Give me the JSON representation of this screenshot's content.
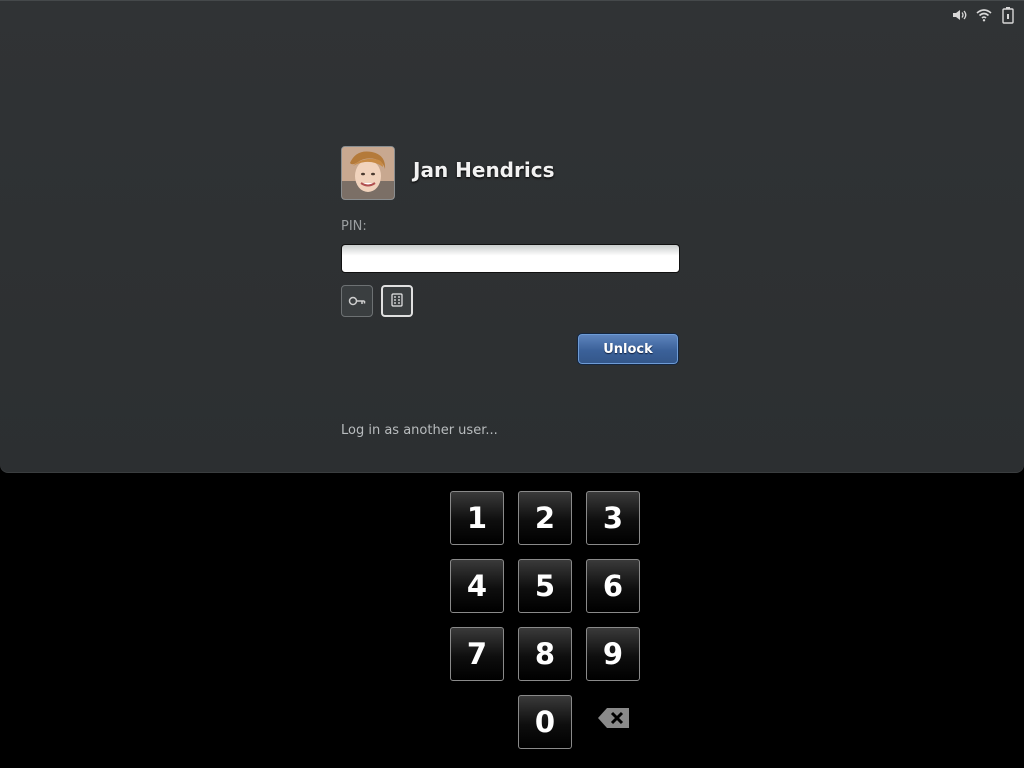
{
  "status_icons": [
    "volume-icon",
    "wifi-icon",
    "battery-icon"
  ],
  "user": {
    "name": "Jan Hendrics"
  },
  "login": {
    "pin_label": "PIN:",
    "pin_value": "",
    "unlock_label": "Unlock",
    "other_user_label": "Log in as another user..."
  },
  "auth_methods": [
    "password-key-icon",
    "pin-keypad-icon"
  ],
  "keypad": {
    "keys": [
      "1",
      "2",
      "3",
      "4",
      "5",
      "6",
      "7",
      "8",
      "9",
      "0"
    ],
    "backspace_icon": "backspace-icon"
  },
  "colors": {
    "panel": "#2e3133",
    "accent": "#3b6199",
    "background": "#000000"
  }
}
